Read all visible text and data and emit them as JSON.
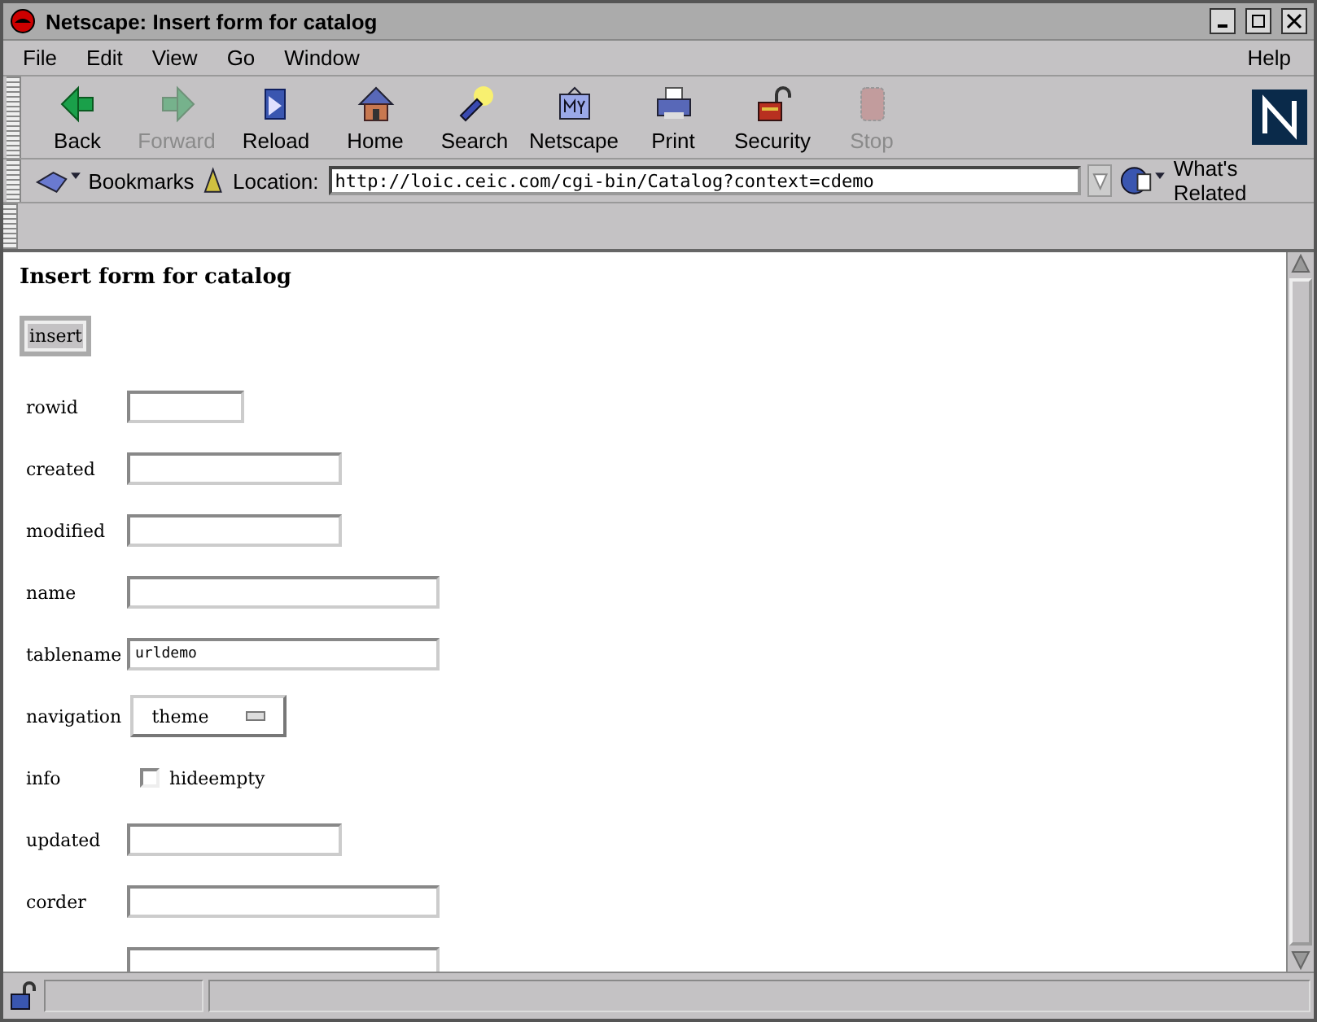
{
  "window": {
    "title": "Netscape: Insert form for catalog"
  },
  "menu": [
    "File",
    "Edit",
    "View",
    "Go",
    "Window"
  ],
  "help_menu": "Help",
  "toolbar": [
    {
      "label": "Back",
      "kind": "back",
      "disabled": false
    },
    {
      "label": "Forward",
      "kind": "forward",
      "disabled": true
    },
    {
      "label": "Reload",
      "kind": "reload",
      "disabled": false
    },
    {
      "label": "Home",
      "kind": "home",
      "disabled": false
    },
    {
      "label": "Search",
      "kind": "search",
      "disabled": false
    },
    {
      "label": "Netscape",
      "kind": "netscape",
      "disabled": false
    },
    {
      "label": "Print",
      "kind": "print",
      "disabled": false
    },
    {
      "label": "Security",
      "kind": "security",
      "disabled": false
    },
    {
      "label": "Stop",
      "kind": "stop",
      "disabled": true
    }
  ],
  "location_bar": {
    "bookmarks": "Bookmarks",
    "location_label": "Location:",
    "url": "http://loic.ceic.com/cgi-bin/Catalog?context=cdemo",
    "related": "What's Related"
  },
  "page": {
    "heading": "Insert form for catalog",
    "submit": "insert",
    "fields": [
      {
        "kind": "text",
        "label": "rowid"
      },
      {
        "kind": "text",
        "label": "created"
      },
      {
        "kind": "text",
        "label": "modified"
      },
      {
        "kind": "text",
        "label": "name"
      },
      {
        "kind": "text",
        "label": "tablename",
        "value": "urldemo"
      },
      {
        "kind": "select",
        "label": "navigation",
        "value": "theme"
      },
      {
        "kind": "checkbox",
        "label": "info",
        "option": "hideempty",
        "checked": false
      },
      {
        "kind": "text",
        "label": "updated"
      },
      {
        "kind": "text",
        "label": "corder"
      },
      {
        "kind": "text"
      }
    ]
  }
}
